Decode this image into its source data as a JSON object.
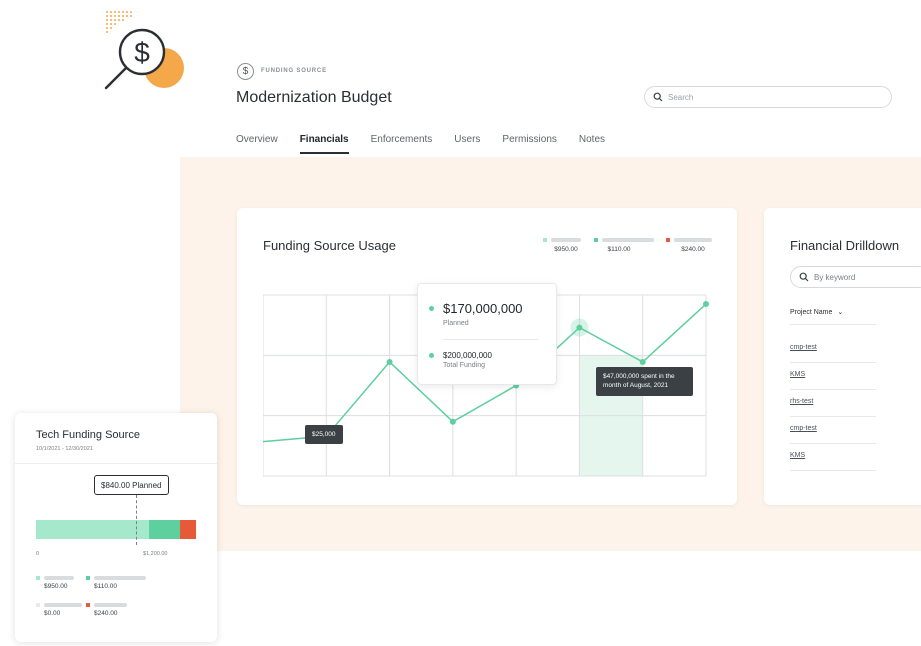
{
  "header": {
    "subtitle": "FUNDING SOURCE",
    "title": "Modernization Budget",
    "icon": "dollar-circle-icon"
  },
  "search": {
    "placeholder": "Search"
  },
  "tabs": [
    {
      "label": "Overview",
      "active": false
    },
    {
      "label": "Financials",
      "active": true
    },
    {
      "label": "Enforcements",
      "active": false
    },
    {
      "label": "Users",
      "active": false
    },
    {
      "label": "Permissions",
      "active": false
    },
    {
      "label": "Notes",
      "active": false
    }
  ],
  "colors": {
    "accent_green": "#5ecf9f",
    "light_green": "#a6e8cc",
    "mint": "#cfeee0",
    "red": "#e65a37",
    "orange": "#f5a84a",
    "light_gray": "#d9dcdf",
    "peach_bg": "#fdf3ea",
    "dark_tooltip": "#3a4044"
  },
  "usage_card": {
    "title": "Funding Source Usage",
    "legend": [
      {
        "value": "$950.00",
        "color": "#a6e8cc"
      },
      {
        "value": "$110.00",
        "color": "#5ecf9f"
      },
      {
        "value": "$240.00",
        "color": "#e65a37"
      }
    ],
    "tooltip_main": {
      "planned_value": "$170,000,000",
      "planned_label": "Planned",
      "total_value": "$200,000,000",
      "total_label": "Total Funding"
    },
    "tooltip_low": "$25,000",
    "tooltip_august": "$47,000,000 spent in the month of August, 2021"
  },
  "chart_data": {
    "type": "line",
    "x": [
      0,
      1,
      2,
      3,
      4,
      5,
      6,
      7
    ],
    "values": [
      0.19,
      0.22,
      0.63,
      0.3,
      0.5,
      0.82,
      0.63,
      0.95
    ],
    "ylim": [
      0,
      1
    ],
    "grid": true,
    "highlight_index": 5
  },
  "drilldown": {
    "title": "Financial Drilldown",
    "search_placeholder": "By keyword",
    "column_header": "Project Name",
    "rows": [
      "cmp-test",
      "KMS",
      "rhs-test",
      "cmp-test",
      "KMS"
    ]
  },
  "tech_card": {
    "title": "Tech Funding Source",
    "dates": "10/1/2021 - 12/30/2021",
    "planned_label": "$840.00 Planned",
    "tick_min": "0",
    "tick_max": "$1,200.00",
    "segments": [
      {
        "value": 950,
        "color": "#a6e8cc"
      },
      {
        "value": 260,
        "color": "#5ecf9f"
      },
      {
        "value": 130,
        "color": "#e65a37"
      }
    ],
    "planned_fraction": 0.625,
    "legend": [
      {
        "value": "$950.00",
        "color": "#a6e8cc"
      },
      {
        "value": "$110.00",
        "color": "#5ecf9f"
      },
      {
        "value": "$0.00",
        "color": "#e8eaec"
      },
      {
        "value": "$240.00",
        "color": "#e65a37"
      }
    ]
  }
}
